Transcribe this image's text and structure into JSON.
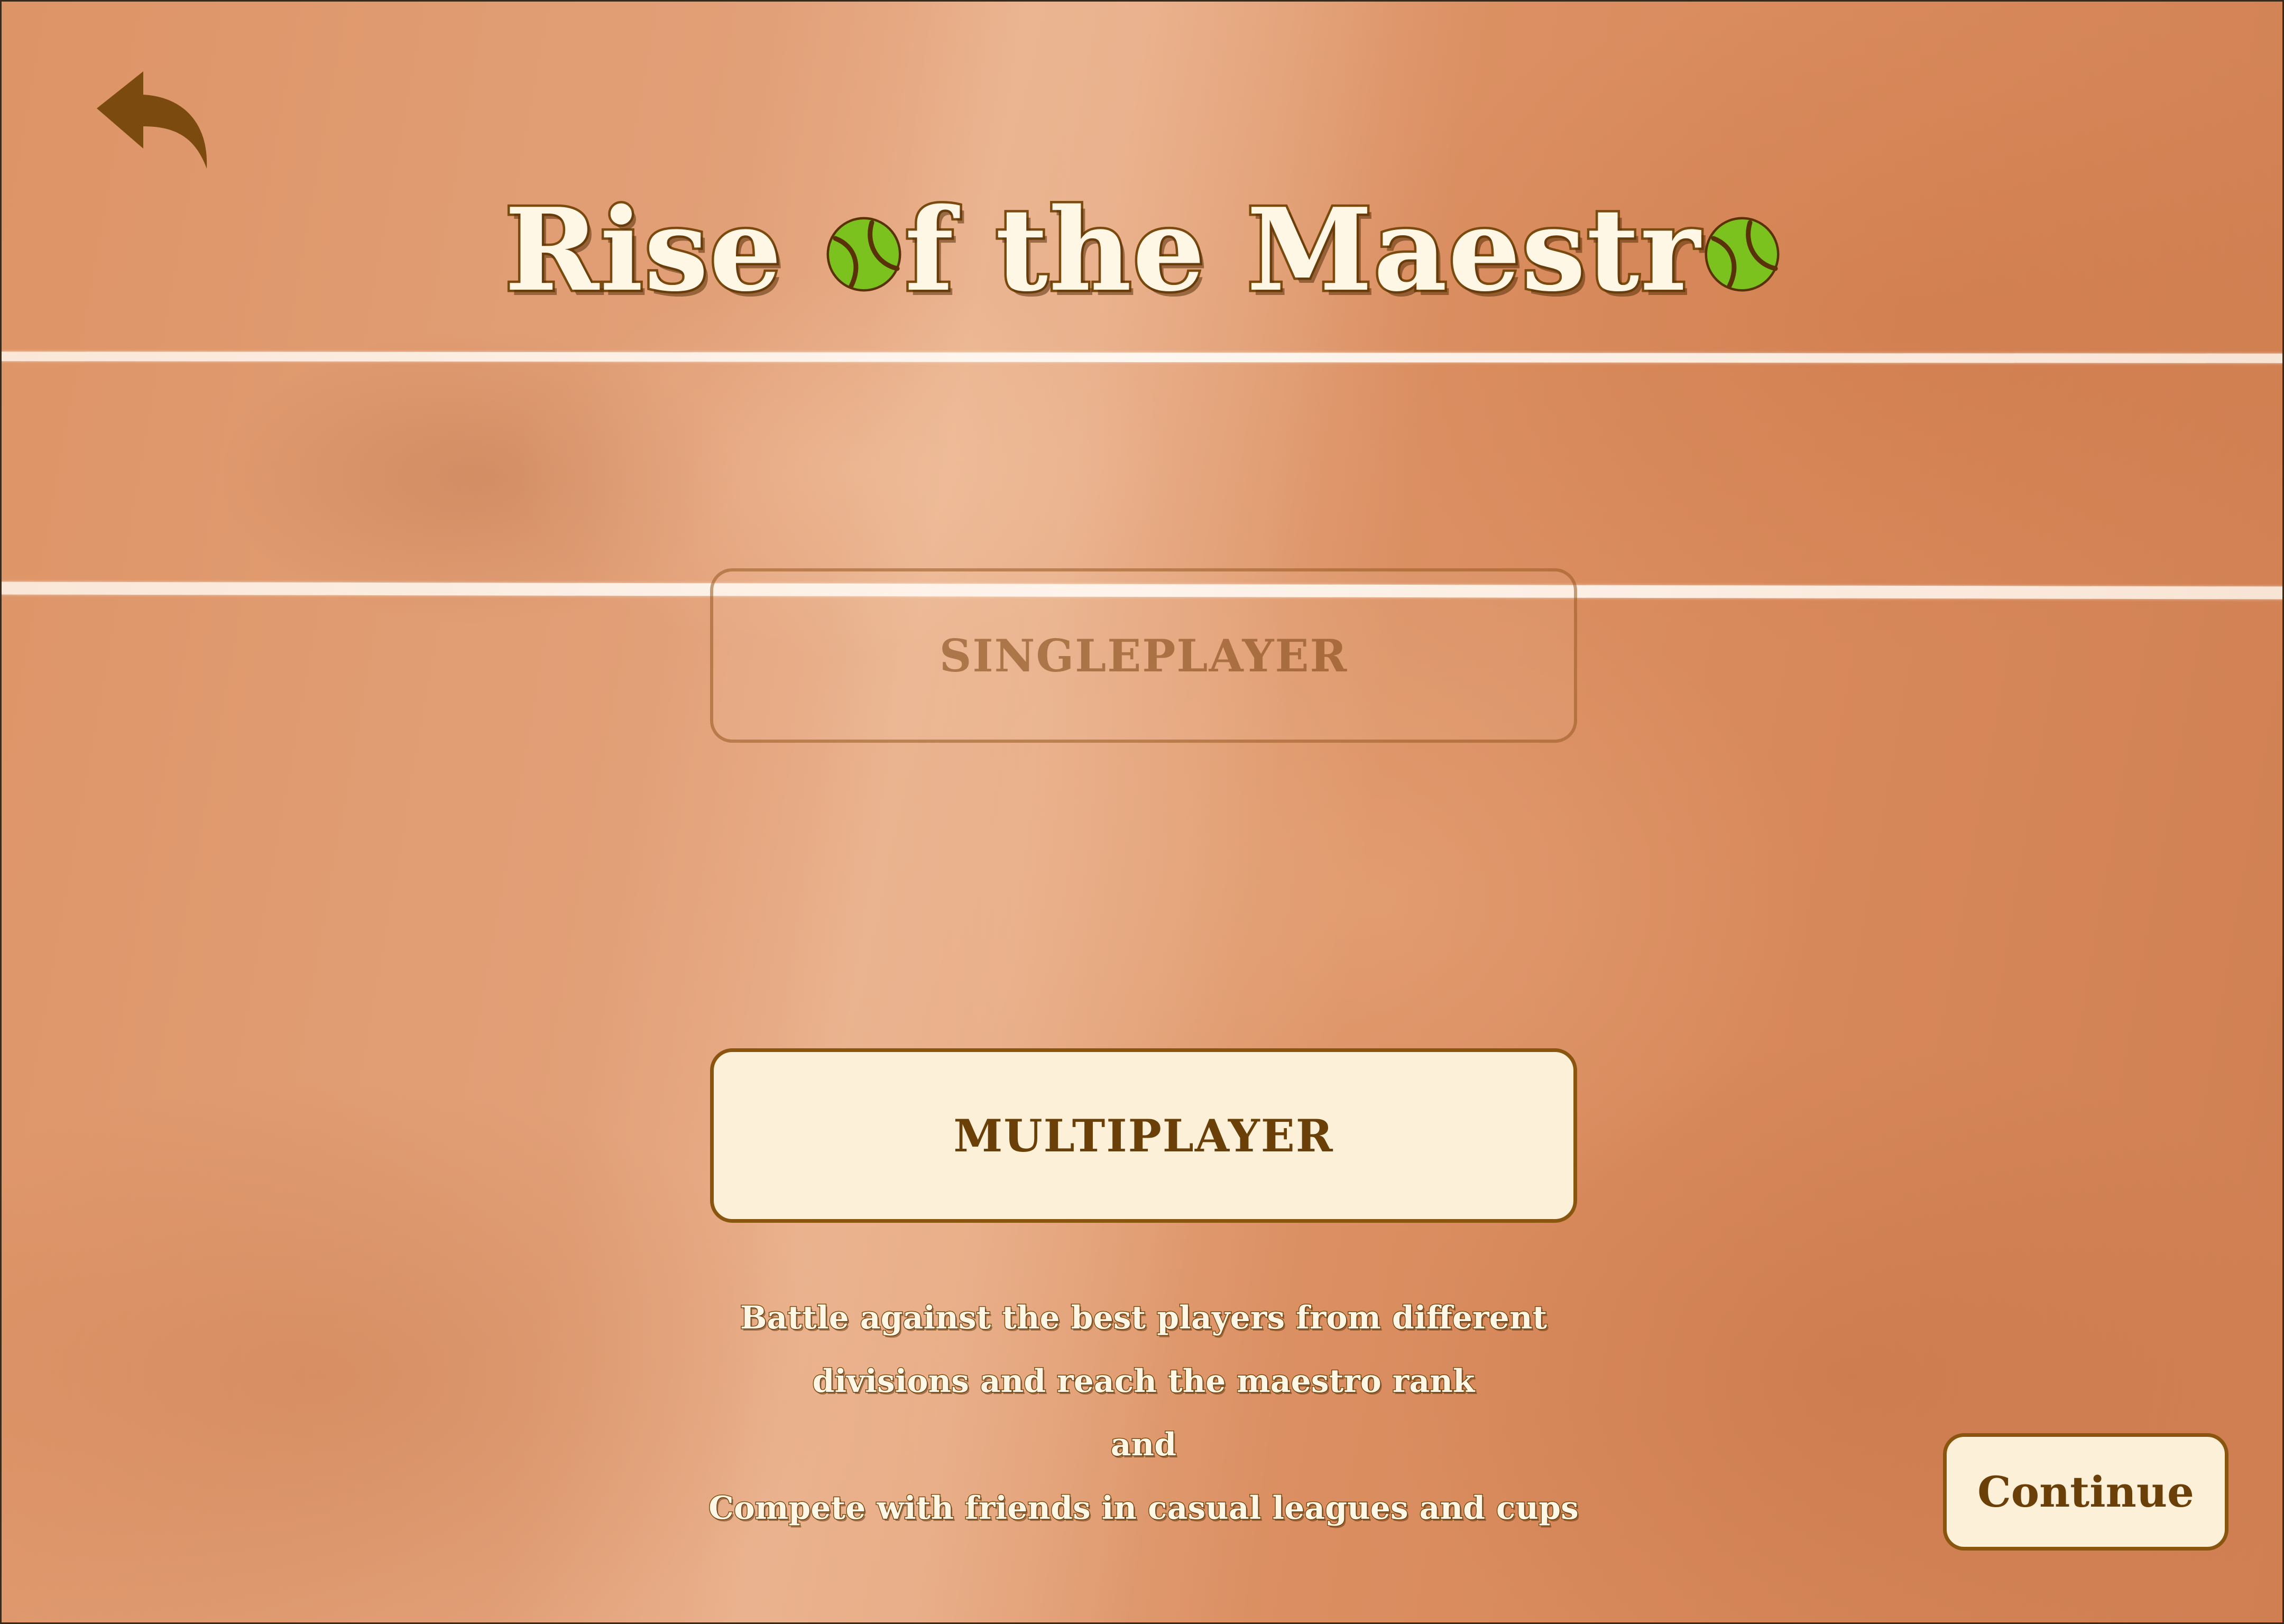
{
  "title": {
    "part1": "Rise ",
    "part2": "f the Maestr",
    "ball_icon": "tennis-ball-icon"
  },
  "nav": {
    "back_icon": "back-arrow-icon"
  },
  "modes": {
    "singleplayer_label": "SINGLEPLAYER",
    "multiplayer_label": "MULTIPLAYER",
    "selected": "multiplayer"
  },
  "description": {
    "line1": "Battle against the best players from different",
    "line2": "divisions and reach the maestro rank",
    "line3": "and",
    "line4": "Compete with friends in casual leagues and cups"
  },
  "footer": {
    "continue_label": "Continue"
  },
  "colors": {
    "accent": "#8a560f",
    "button_bg": "#fdf0d8",
    "title_fill": "#fff7e6",
    "ball": "#7cc21e",
    "court": "#dd9466"
  }
}
